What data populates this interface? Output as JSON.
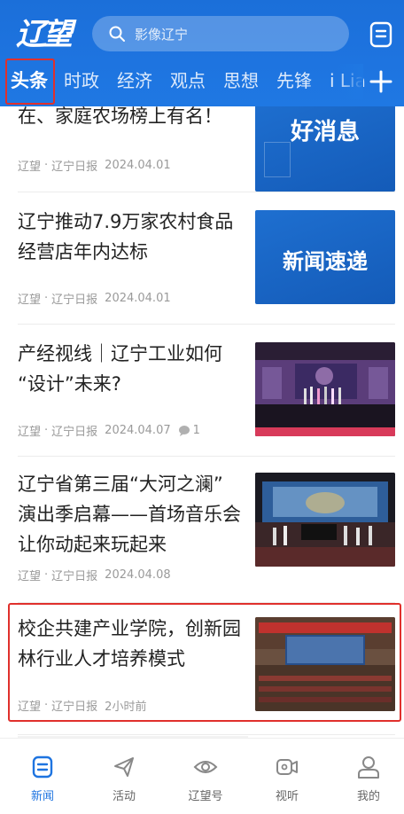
{
  "header": {
    "logo_text": "辽望",
    "search_placeholder": "影像辽宁",
    "tabs": [
      "头条",
      "时政",
      "经济",
      "观点",
      "思想",
      "先锋",
      "i Lia"
    ],
    "active_tab": "头条"
  },
  "feed": {
    "items": [
      {
        "title_lines": [
          "在、家庭农场榜上有名！"
        ],
        "source": "辽望",
        "publisher": "辽宁日报",
        "date": "2024.04.01",
        "thumb_text": "好消息"
      },
      {
        "title_lines": [
          "辽宁推动7.9万家农村食品",
          "经营店年内达标"
        ],
        "source": "辽望",
        "publisher": "辽宁日报",
        "date": "2024.04.01",
        "thumb_text": "新闻速递"
      },
      {
        "title_lines": [
          "产经视线｜辽宁工业如何",
          "“设计”未来?"
        ],
        "source": "辽望",
        "publisher": "辽宁日报",
        "date": "2024.04.07",
        "comments": "1"
      },
      {
        "title_lines": [
          "辽宁省第三届“大河之澜”",
          "演出季启幕——首场音乐会",
          "让你动起来玩起来"
        ],
        "source": "辽望",
        "publisher": "辽宁日报",
        "date": "2024.04.08"
      },
      {
        "title_lines": [
          "校企共建产业学院，创新园",
          "林行业人才培养模式"
        ],
        "source": "辽望",
        "publisher": "辽宁日报",
        "date": "2小时前"
      }
    ],
    "separator": "·"
  },
  "bottom_nav": [
    {
      "label": "新闻",
      "icon": "news-icon",
      "active": true
    },
    {
      "label": "活动",
      "icon": "send-icon",
      "active": false
    },
    {
      "label": "辽望号",
      "icon": "eye-icon",
      "active": false
    },
    {
      "label": "视听",
      "icon": "video-icon",
      "active": false
    },
    {
      "label": "我的",
      "icon": "user-icon",
      "active": false
    }
  ],
  "colors": {
    "brand_blue": "#1e74e0",
    "highlight_red": "#e0302c",
    "meta_gray": "#9a9a9a"
  }
}
